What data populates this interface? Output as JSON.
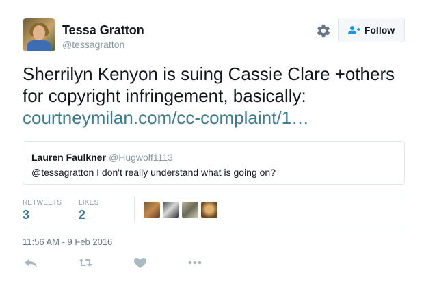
{
  "author": {
    "name": "Tessa Gratton",
    "handle": "@tessagratton"
  },
  "header": {
    "follow_label": "Follow"
  },
  "tweet": {
    "text": "Sherrilyn Kenyon is suing Cassie Clare +others for copyright infringement, basically: ",
    "link_text": "courtneymilan.com/cc-complaint/1…"
  },
  "quote": {
    "name": "Lauren Faulkner",
    "handle": "@Hugwolf1113",
    "text": "@tessagratton I don't really understand what is going on?"
  },
  "stats": {
    "retweets_label": "RETWEETS",
    "retweets_value": "3",
    "likes_label": "LIKES",
    "likes_value": "2"
  },
  "timestamp": "11:56 AM - 9 Feb 2016",
  "colors": {
    "link": "#3a7d8c",
    "muted": "#8899a6",
    "border": "#e1e8ed"
  },
  "icons": [
    "gear-icon",
    "follow-person-plus-icon",
    "reply-icon",
    "retweet-icon",
    "like-heart-icon",
    "more-dots-icon"
  ]
}
